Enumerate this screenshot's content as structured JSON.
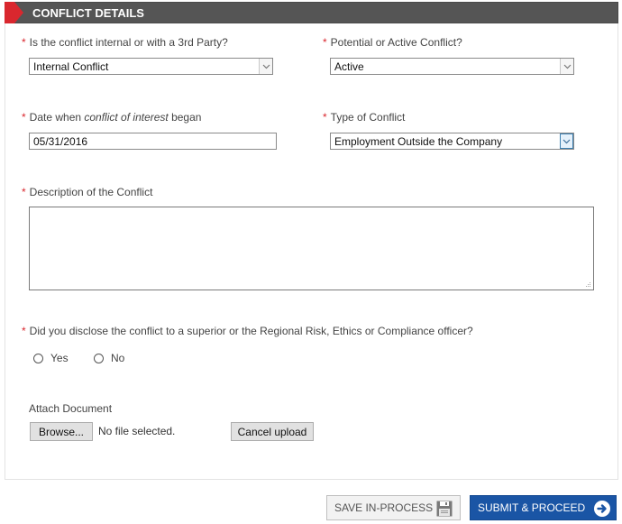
{
  "section": {
    "title": "CONFLICT DETAILS"
  },
  "fields": {
    "conflict_party": {
      "required_mark": "*",
      "label": "Is the conflict internal or with a 3rd Party?",
      "value": "Internal Conflict"
    },
    "conflict_status": {
      "required_mark": "*",
      "label": "Potential or Active Conflict?",
      "value": "Active"
    },
    "date_began": {
      "required_mark": "*",
      "label_pre": "Date when ",
      "label_em": "conflict of interest",
      "label_post": " began",
      "value": "05/31/2016"
    },
    "conflict_type": {
      "required_mark": "*",
      "label": "Type of Conflict",
      "value": "Employment Outside the Company"
    },
    "description": {
      "required_mark": "*",
      "label": "Description of the Conflict",
      "value": ""
    },
    "disclosed": {
      "required_mark": "*",
      "label": "Did you disclose the conflict to a superior or the Regional Risk, Ethics or Compliance officer?",
      "options": [
        "Yes",
        "No"
      ]
    },
    "attachment": {
      "label": "Attach Document",
      "browse_label": "Browse...",
      "status": "No file selected.",
      "cancel_label": "Cancel upload"
    }
  },
  "actions": {
    "save_label": "SAVE IN-PROCESS",
    "submit_label": "SUBMIT & PROCEED"
  },
  "colors": {
    "header_bg": "#555555",
    "accent_red": "#d9272e",
    "primary_blue": "#1a55a5"
  }
}
